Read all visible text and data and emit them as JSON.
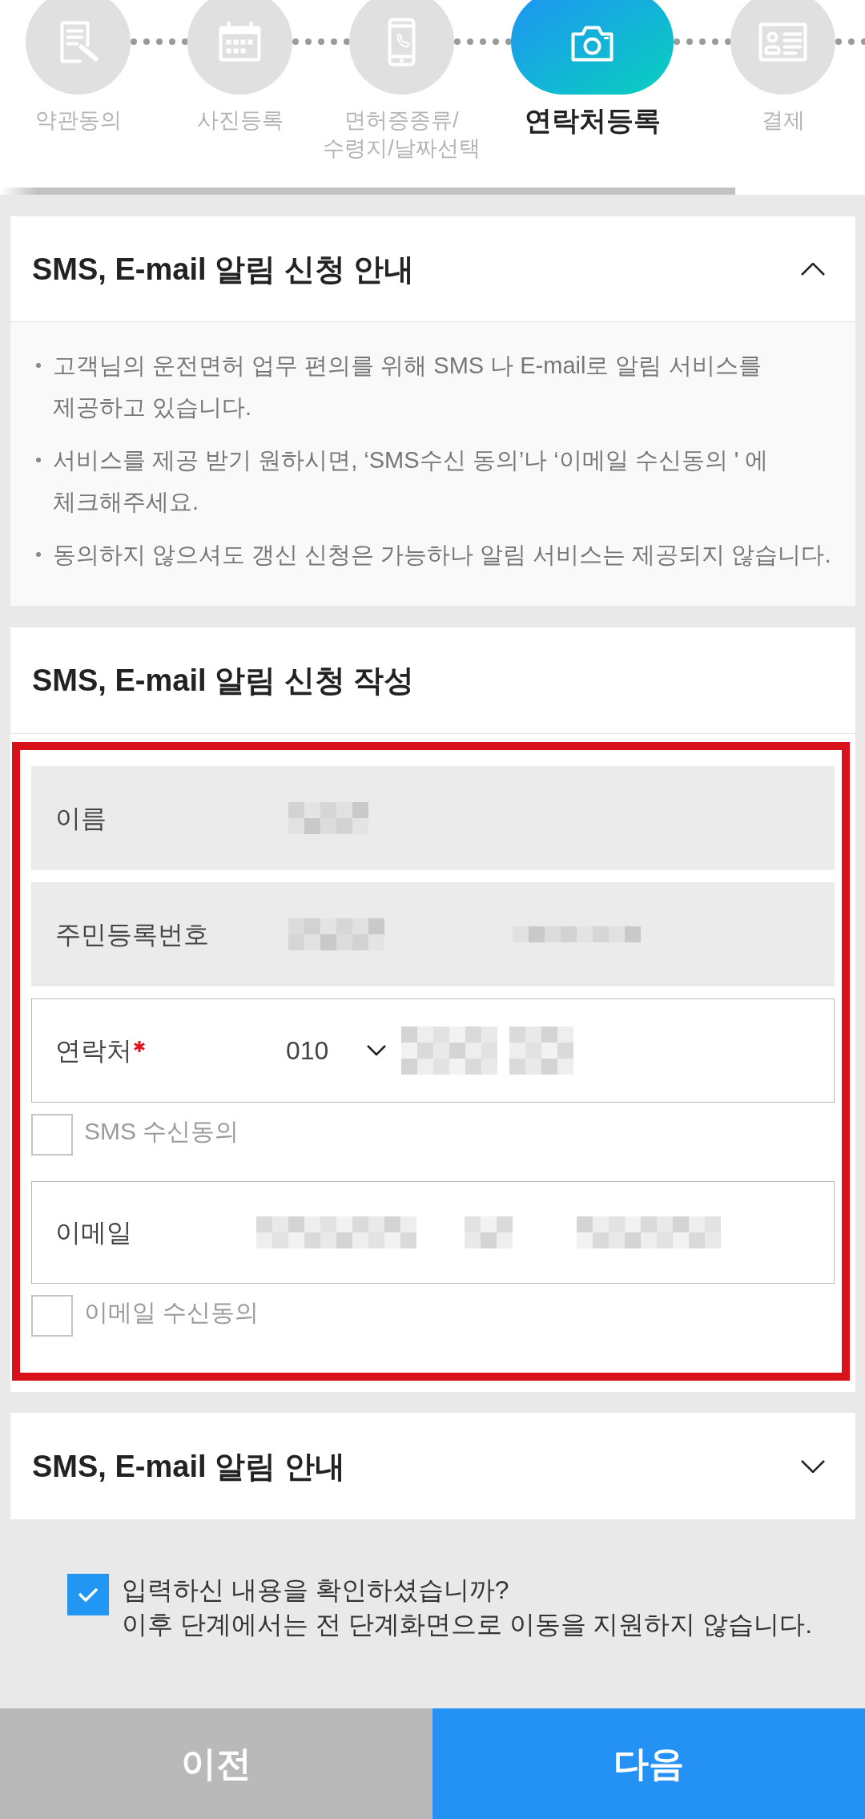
{
  "steps": [
    {
      "label": "약관동의",
      "selected": false
    },
    {
      "label": "사진등록",
      "selected": false
    },
    {
      "label": "면허증종류/\n수령지/날짜선택",
      "selected": false
    },
    {
      "label": "연락처등록",
      "selected": true
    },
    {
      "label": "결제",
      "selected": false
    }
  ],
  "progress": {
    "level": 0.85
  },
  "notice_section": {
    "title": "SMS, E-mail 알림 신청 안내",
    "expanded": true,
    "bullets": [
      "고객님의 운전면허 업무 편의를 위해 SMS 나 E-mail로 알림 서비스를 제공하고 있습니다.",
      "서비스를 제공 받기 원하시면, ‘SMS수신 동의’나 ‘이메일 수신동의 ' 에 체크해주세요.",
      "동의하지 않으셔도 갱신 신청은 가능하나 알림 서비스는 제공되지 않습니다."
    ]
  },
  "form_section": {
    "title": "SMS, E-mail 알림 신청 작성",
    "highlighted": true,
    "rows": [
      {
        "kind": "readonly",
        "label": "이름",
        "required": false,
        "redacted": true
      },
      {
        "kind": "readonly",
        "label": "주민등록번호",
        "required": false,
        "redacted": true
      },
      {
        "kind": "phone",
        "label": "연락처",
        "required": true,
        "prefix": "010",
        "redacted": true
      },
      {
        "kind": "checkbox",
        "label": "SMS 수신동의",
        "checked": false
      },
      {
        "kind": "input",
        "label": "이메일",
        "required": false,
        "redacted": true
      },
      {
        "kind": "checkbox",
        "label": "이메일 수신동의",
        "checked": false
      }
    ]
  },
  "guide_section": {
    "title": "SMS, E-mail 알림 안내",
    "expanded": false
  },
  "confirm": {
    "checked": true,
    "text": "입력하신 내용을 확인하셨습니까?\n이후 단계에서는 전 단계화면으로 이동을 지원하지 않습니다."
  },
  "buttons": [
    {
      "kind": "secondary",
      "label": "이전"
    },
    {
      "kind": "primary",
      "label": "다음"
    }
  ]
}
